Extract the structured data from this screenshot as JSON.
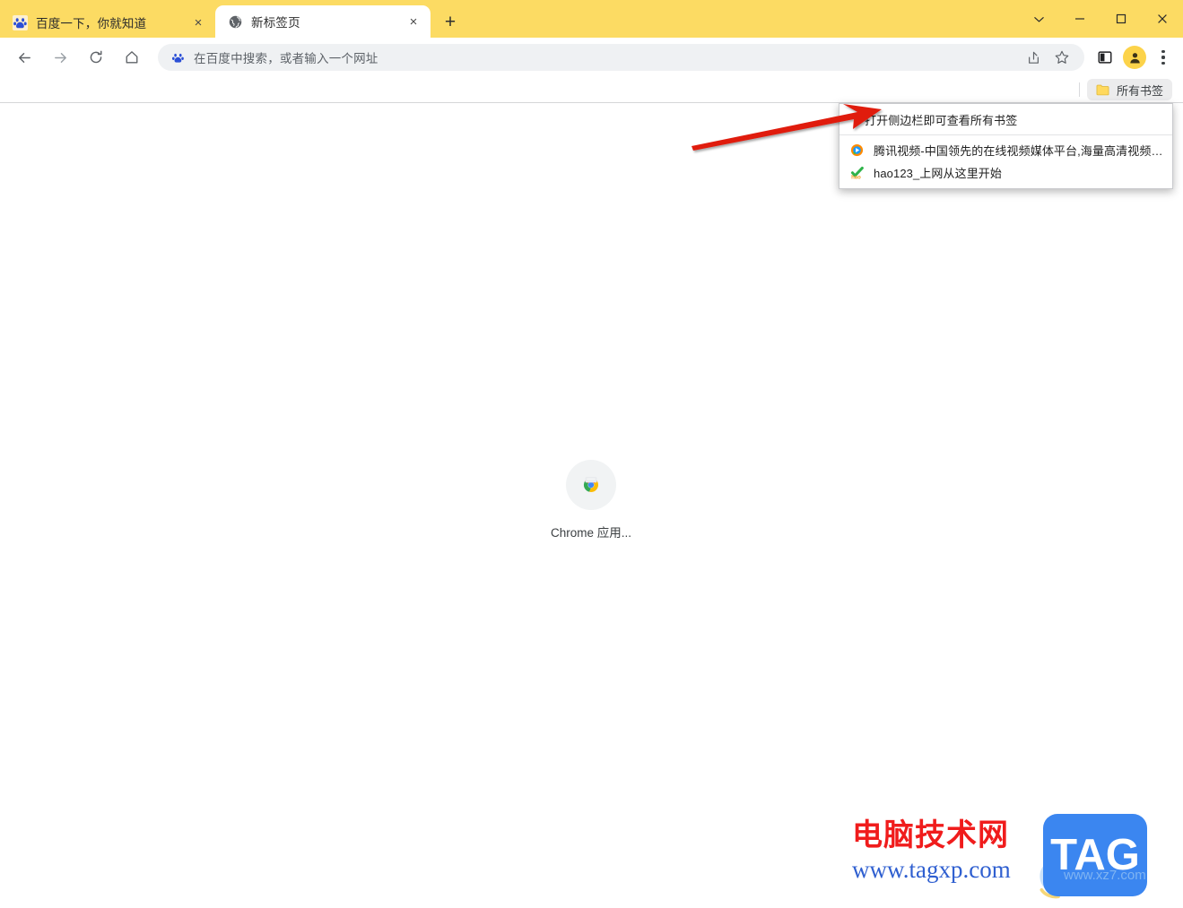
{
  "window": {
    "controls": [
      {
        "name": "tab-search",
        "glyph": "chevron-down"
      },
      {
        "name": "minimize",
        "glyph": "minus"
      },
      {
        "name": "maximize",
        "glyph": "square"
      },
      {
        "name": "close",
        "glyph": "cross"
      }
    ]
  },
  "tabs": [
    {
      "title": "百度一下，你就知道",
      "favicon": "baidu-paw-icon",
      "active": false,
      "close_label": "×"
    },
    {
      "title": "新标签页",
      "favicon": "globe-icon",
      "active": true,
      "close_label": "×"
    }
  ],
  "newtab_button": {
    "label": "+",
    "name": "new-tab-button"
  },
  "toolbar": {
    "back_icon": "arrow-left-icon",
    "forward_icon": "arrow-right-icon",
    "reload_icon": "reload-icon",
    "home_icon": "home-icon",
    "omnibox": {
      "placeholder": "在百度中搜索，或者输入一个网址",
      "value": "",
      "leading_icon": "baidu-paw-icon"
    },
    "share_icon": "share-icon",
    "bookmark_star_icon": "star-icon",
    "side_panel_icon": "side-panel-icon",
    "avatar_icon": "profile-avatar-icon",
    "menu_icon": "three-dot-menu-icon"
  },
  "bookmarks_bar": {
    "all_bookmarks_label": "所有书签",
    "folder_icon": "folder-icon"
  },
  "bookmarks_menu": {
    "header": "打开侧边栏即可查看所有书签",
    "items": [
      {
        "label": "腾讯视频-中国领先的在线视频媒体平台,海量高清视频在线观看",
        "icon": "tencent-video-icon"
      },
      {
        "label": "hao123_上网从这里开始",
        "icon": "hao123-icon"
      }
    ]
  },
  "page": {
    "shortcut": {
      "label": "Chrome 应用...",
      "icon": "chrome-apps-icon"
    }
  },
  "watermark": {
    "title_cn": "电脑技术网",
    "url": "www.tagxp.com",
    "logo_text": "TAG",
    "sub_url": "www.xz7.com",
    "colors": {
      "title": "#f01c1c",
      "url": "#2f5fd0",
      "logo_bg": "#3b86f0"
    }
  },
  "colors": {
    "theme_yellow": "#fcdb63",
    "avatar_yellow": "#fcd34a",
    "omnibox_bg": "#eff1f3",
    "annotation_red": "#e01b0e"
  }
}
